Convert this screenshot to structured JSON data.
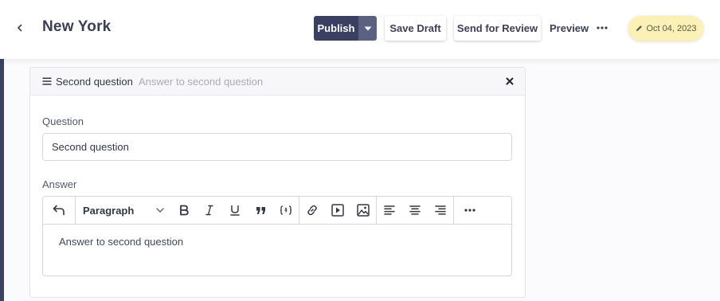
{
  "header": {
    "title": "New York",
    "publish_label": "Publish",
    "save_draft_label": "Save Draft",
    "send_review_label": "Send for Review",
    "preview_label": "Preview",
    "date": "Oct 04, 2023",
    "colors": {
      "publish_bg": "#3b4062",
      "publish_caret_bg": "#5b6180",
      "date_badge_bg": "#fbf0b6",
      "rail": "#3c4160"
    },
    "icons": [
      "chevron-left-icon",
      "caret-down-icon",
      "more-horizontal-icon",
      "pencil-icon"
    ]
  },
  "panel": {
    "title": "Second question",
    "subtitle": "Answer to second question",
    "icons": [
      "drag-handle-icon",
      "close-icon"
    ],
    "question": {
      "label": "Question",
      "value": "Second question"
    },
    "answer": {
      "label": "Answer",
      "block_format": "Paragraph",
      "content": "Answer to second question",
      "toolbar_icons": [
        "undo-icon",
        "chevron-down-icon",
        "bold-icon",
        "italic-icon",
        "underline-icon",
        "quote-icon",
        "code-block-icon",
        "link-icon",
        "video-icon",
        "image-icon",
        "align-left-icon",
        "align-center-icon",
        "align-right-icon",
        "more-horizontal-icon"
      ]
    }
  }
}
